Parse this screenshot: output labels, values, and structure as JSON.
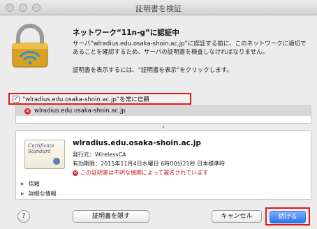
{
  "window": {
    "title": "証明書を検証"
  },
  "header": {
    "heading": "ネットワーク“11n-g”に認証中",
    "message": "サーバ“wlradius.edu.osaka-shoin.ac.jp”に認証する前に、このネットワークに適切であることを確認するため、サーバの証明書を検査しなければなりません。",
    "instruction": "証明書を表示するには、“証明書を表示”をクリックします。"
  },
  "trust": {
    "checked": true,
    "label": "“wlradius.edu.osaka-shoin.ac.jp”を常に信頼"
  },
  "tree": {
    "items": [
      {
        "label": "wlradius.edu.osaka-shoin.ac.jp",
        "status": "error"
      }
    ]
  },
  "certificate": {
    "image_text": "Certificate\nStandard",
    "common_name": "wlradius.edu.osaka-shoin.ac.jp",
    "issuer": "発行元：WirelessCA",
    "expires": "有効期限：2015年11月4日水曜日 6時00分21秒 日本標準時",
    "warning": "この証明書は不明な機関によって署名されています"
  },
  "disclosures": [
    {
      "label": "信頼"
    },
    {
      "label": "詳細な情報"
    }
  ],
  "buttons": {
    "help": "?",
    "hide_certificate": "証明書を隠す",
    "cancel": "キャンセル",
    "continue": "続ける"
  },
  "icons": {
    "lock": "lock-icon",
    "wifi": "wifi-icon",
    "error": "error-icon",
    "certificate": "certificate-icon"
  },
  "colors": {
    "highlight": "#e1191e",
    "error": "#c82027",
    "primary_button": "#2c73e8"
  }
}
